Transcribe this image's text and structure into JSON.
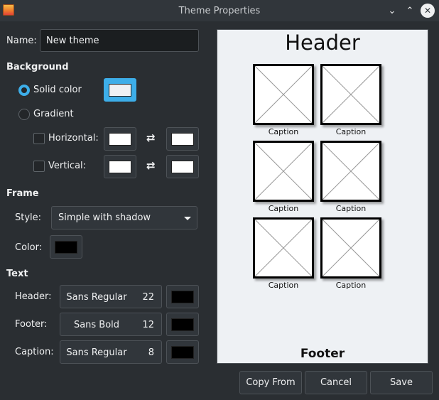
{
  "window": {
    "title": "Theme Properties",
    "app_icon": "image-viewer-icon"
  },
  "name": {
    "label": "Name:",
    "value": "New theme"
  },
  "background": {
    "heading": "Background",
    "solid_label": "Solid color",
    "gradient_label": "Gradient",
    "horizontal_label": "Horizontal:",
    "vertical_label": "Vertical:",
    "solid_selected": true,
    "solid_color": "#eef1f4",
    "gradient_color": "#ffffff"
  },
  "frame": {
    "heading": "Frame",
    "style_label": "Style:",
    "style_value": "Simple with shadow",
    "color_label": "Color:",
    "color": "#000000"
  },
  "text": {
    "heading": "Text",
    "header_label": "Header:",
    "header_font": "Sans Regular",
    "header_size": "22",
    "footer_label": "Footer:",
    "footer_font": "Sans Bold",
    "footer_size": "12",
    "caption_label": "Caption:",
    "caption_font": "Sans Regular",
    "caption_size": "8",
    "color": "#000000"
  },
  "preview": {
    "header": "Header",
    "footer": "Footer",
    "captions": [
      "Caption",
      "Caption",
      "Caption",
      "Caption",
      "Caption",
      "Caption"
    ]
  },
  "buttons": {
    "copy_from": "Copy From",
    "cancel": "Cancel",
    "save": "Save"
  },
  "colors": {
    "accent": "#3daee9",
    "window_bg": "#2a2e32",
    "preview_bg": "#eef1f4"
  }
}
